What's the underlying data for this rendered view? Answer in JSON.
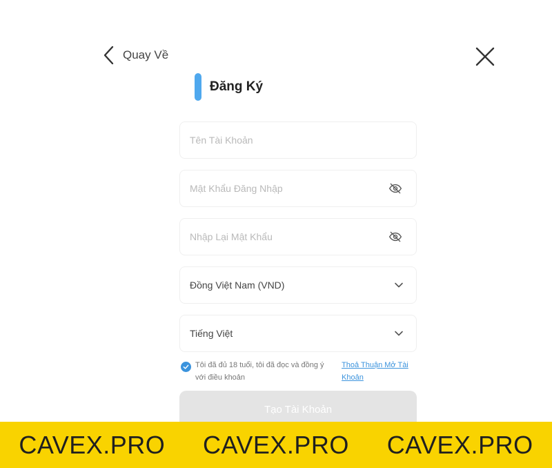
{
  "header": {
    "back_label": "Quay Về",
    "title": "Đăng Ký"
  },
  "form": {
    "username_placeholder": "Tên Tài Khoản",
    "password_placeholder": "Mật Khẩu Đăng Nhập",
    "confirm_password_placeholder": "Nhập Lại Mật Khẩu",
    "currency_value": "Đồng Việt Nam (VND)",
    "language_value": "Tiếng Việt",
    "agree_checked": true,
    "agree_text": "Tôi đã đủ 18 tuổi, tôi đã đọc và đồng ý với điều khoản",
    "agree_link": "Thoả Thuận Mở Tài Khoản",
    "submit_label": "Tạo Tài Khoản"
  },
  "banner": {
    "items": [
      "CAVEX.PRO",
      "CAVEX.PRO",
      "CAVEX.PRO"
    ]
  },
  "colors": {
    "accent": "#4fa8ee",
    "link": "#3b93dd",
    "banner": "#f9d300",
    "button_disabled": "#e4e4e4"
  },
  "icons": {
    "back": "chevron-left-icon",
    "close": "close-icon",
    "password_toggle": "eye-off-icon",
    "dropdown": "chevron-down-icon",
    "check": "check-icon"
  }
}
